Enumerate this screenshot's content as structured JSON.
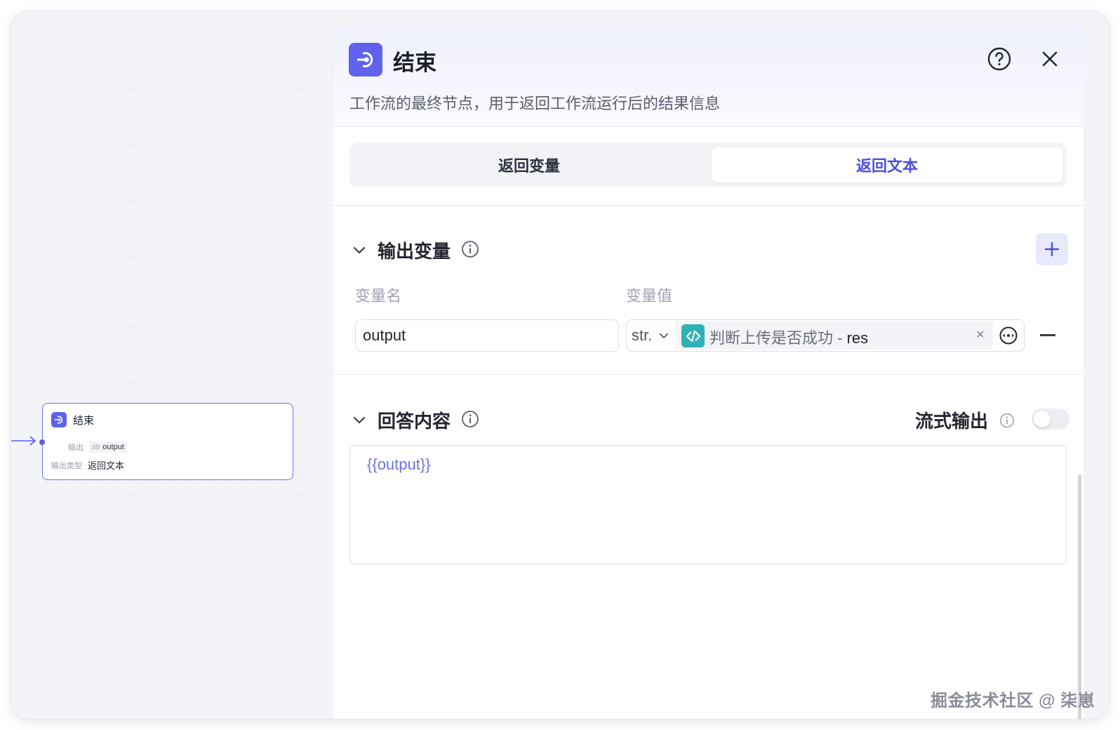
{
  "node": {
    "title": "结束",
    "output_key": "输出",
    "output_type_tag": "str",
    "output_value": "output",
    "type_key": "输出类型",
    "type_value": "返回文本"
  },
  "panel": {
    "title": "结束",
    "description": "工作流的最终节点，用于返回工作流运行后的结果信息",
    "tabs": [
      {
        "label": "返回变量",
        "active": false
      },
      {
        "label": "返回文本",
        "active": true
      }
    ],
    "output_section": {
      "title": "输出变量",
      "col_name_label": "变量名",
      "col_value_label": "变量值",
      "row": {
        "name": "output",
        "type": "str.",
        "ref_node": "判断上传是否成功 - ",
        "ref_var": "res"
      }
    },
    "answer_section": {
      "title": "回答内容",
      "stream_label": "流式输出",
      "stream_enabled": false,
      "content": "{{output}}"
    }
  },
  "colors": {
    "accent": "#5f62ec",
    "code_icon": "#2fb2b6",
    "active_tab_text": "#4b4fe0"
  },
  "watermark": "掘金技术社区 @ 柒崽"
}
